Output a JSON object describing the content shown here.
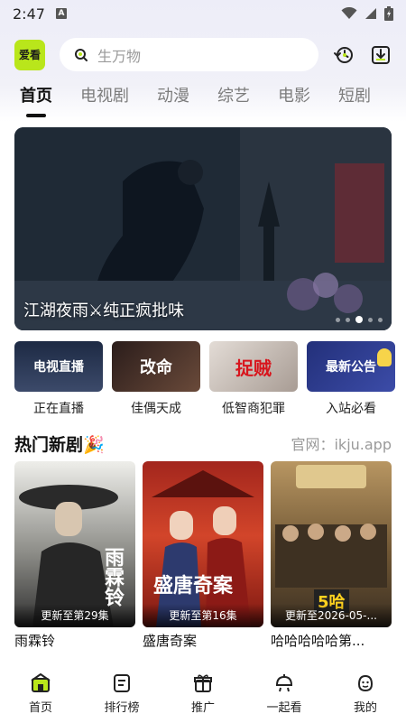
{
  "status": {
    "time": "2:47",
    "a_label": "A"
  },
  "header": {
    "logo_text": "爱看",
    "search_placeholder": "生万物"
  },
  "tabs": [
    {
      "label": "首页",
      "active": true
    },
    {
      "label": "电视剧"
    },
    {
      "label": "动漫"
    },
    {
      "label": "综艺"
    },
    {
      "label": "电影"
    },
    {
      "label": "短剧"
    }
  ],
  "banner": {
    "title": "江湖夜雨⚔纯正疯批味"
  },
  "shortcuts": [
    {
      "thumb_text": "电视直播",
      "label": "正在直播",
      "bg": "#2d3a55"
    },
    {
      "thumb_text": "改命",
      "label": "佳偶天成",
      "bg": "#3a2a28"
    },
    {
      "thumb_text": "捉贼",
      "label": "低智商犯罪",
      "bg": "#c9bfb9"
    },
    {
      "thumb_text": "最新公告",
      "label": "入站必看",
      "bg": "#2e3e86"
    }
  ],
  "section": {
    "title": "热门新剧🎉",
    "right": "官网：ikju.app"
  },
  "dramas": [
    {
      "update": "更新至第29集",
      "title": "雨霖铃",
      "bg_top": "#e9e9e6",
      "bg_bottom": "#3a3a3a",
      "poster_text": "雨霖铃"
    },
    {
      "update": "更新至第16集",
      "title": "盛唐奇案",
      "bg_top": "#b52a1f",
      "bg_bottom": "#7a1411",
      "poster_text": "盛唐奇案"
    },
    {
      "update": "更新至2026-05-...",
      "title": "哈哈哈哈哈第...",
      "bg_top": "#8a6a3b",
      "bg_bottom": "#4a3a26",
      "poster_text": "5哈"
    }
  ],
  "nav": [
    {
      "label": "首页",
      "icon": "home-icon"
    },
    {
      "label": "排行榜",
      "icon": "ranking-icon"
    },
    {
      "label": "推广",
      "icon": "gift-icon"
    },
    {
      "label": "一起看",
      "icon": "watch-together-icon"
    },
    {
      "label": "我的",
      "icon": "profile-icon"
    }
  ],
  "colors": {
    "accent": "#b9e61b",
    "text": "#111111",
    "muted": "#9a9a9a"
  }
}
